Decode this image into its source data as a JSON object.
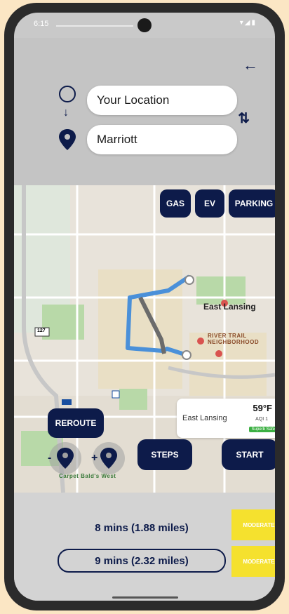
{
  "status_bar": {
    "time": "6:15",
    "icons": "▾◢▮"
  },
  "header": {
    "back_icon": "arrow-left-icon",
    "swap_icon": "swap-vertical-icon"
  },
  "search": {
    "origin_value": "Your Location",
    "destination_value": "Marriott"
  },
  "filters": {
    "gas_label": "GAS",
    "ev_label": "EV",
    "parking_label": "PARKING"
  },
  "map": {
    "labels": {
      "east_lansing": "East Lansing",
      "neighborhood": "RIVER TRAIL NEIGHBORHOOD",
      "park": "Carpet Bald's West",
      "highway_127": "127"
    },
    "route_colors": {
      "primary": "#4a90d9",
      "alternate": "#7a7a7a"
    }
  },
  "weather": {
    "city": "East Lansing",
    "temperature": "59°F",
    "aqi": "AQI 1",
    "quality": "Superb Safe"
  },
  "actions": {
    "reroute_label": "REROUTE",
    "steps_label": "STEPS",
    "start_label": "START"
  },
  "routes": [
    {
      "summary": "8 mins (1.88 miles)",
      "badge": "MODERATE"
    },
    {
      "summary": "9 mins (2.32 miles)",
      "badge": "MODERATE"
    }
  ],
  "colors": {
    "accent": "#0d1b4a",
    "badge": "#f5e12e",
    "alt_route": "#4a90d9"
  }
}
